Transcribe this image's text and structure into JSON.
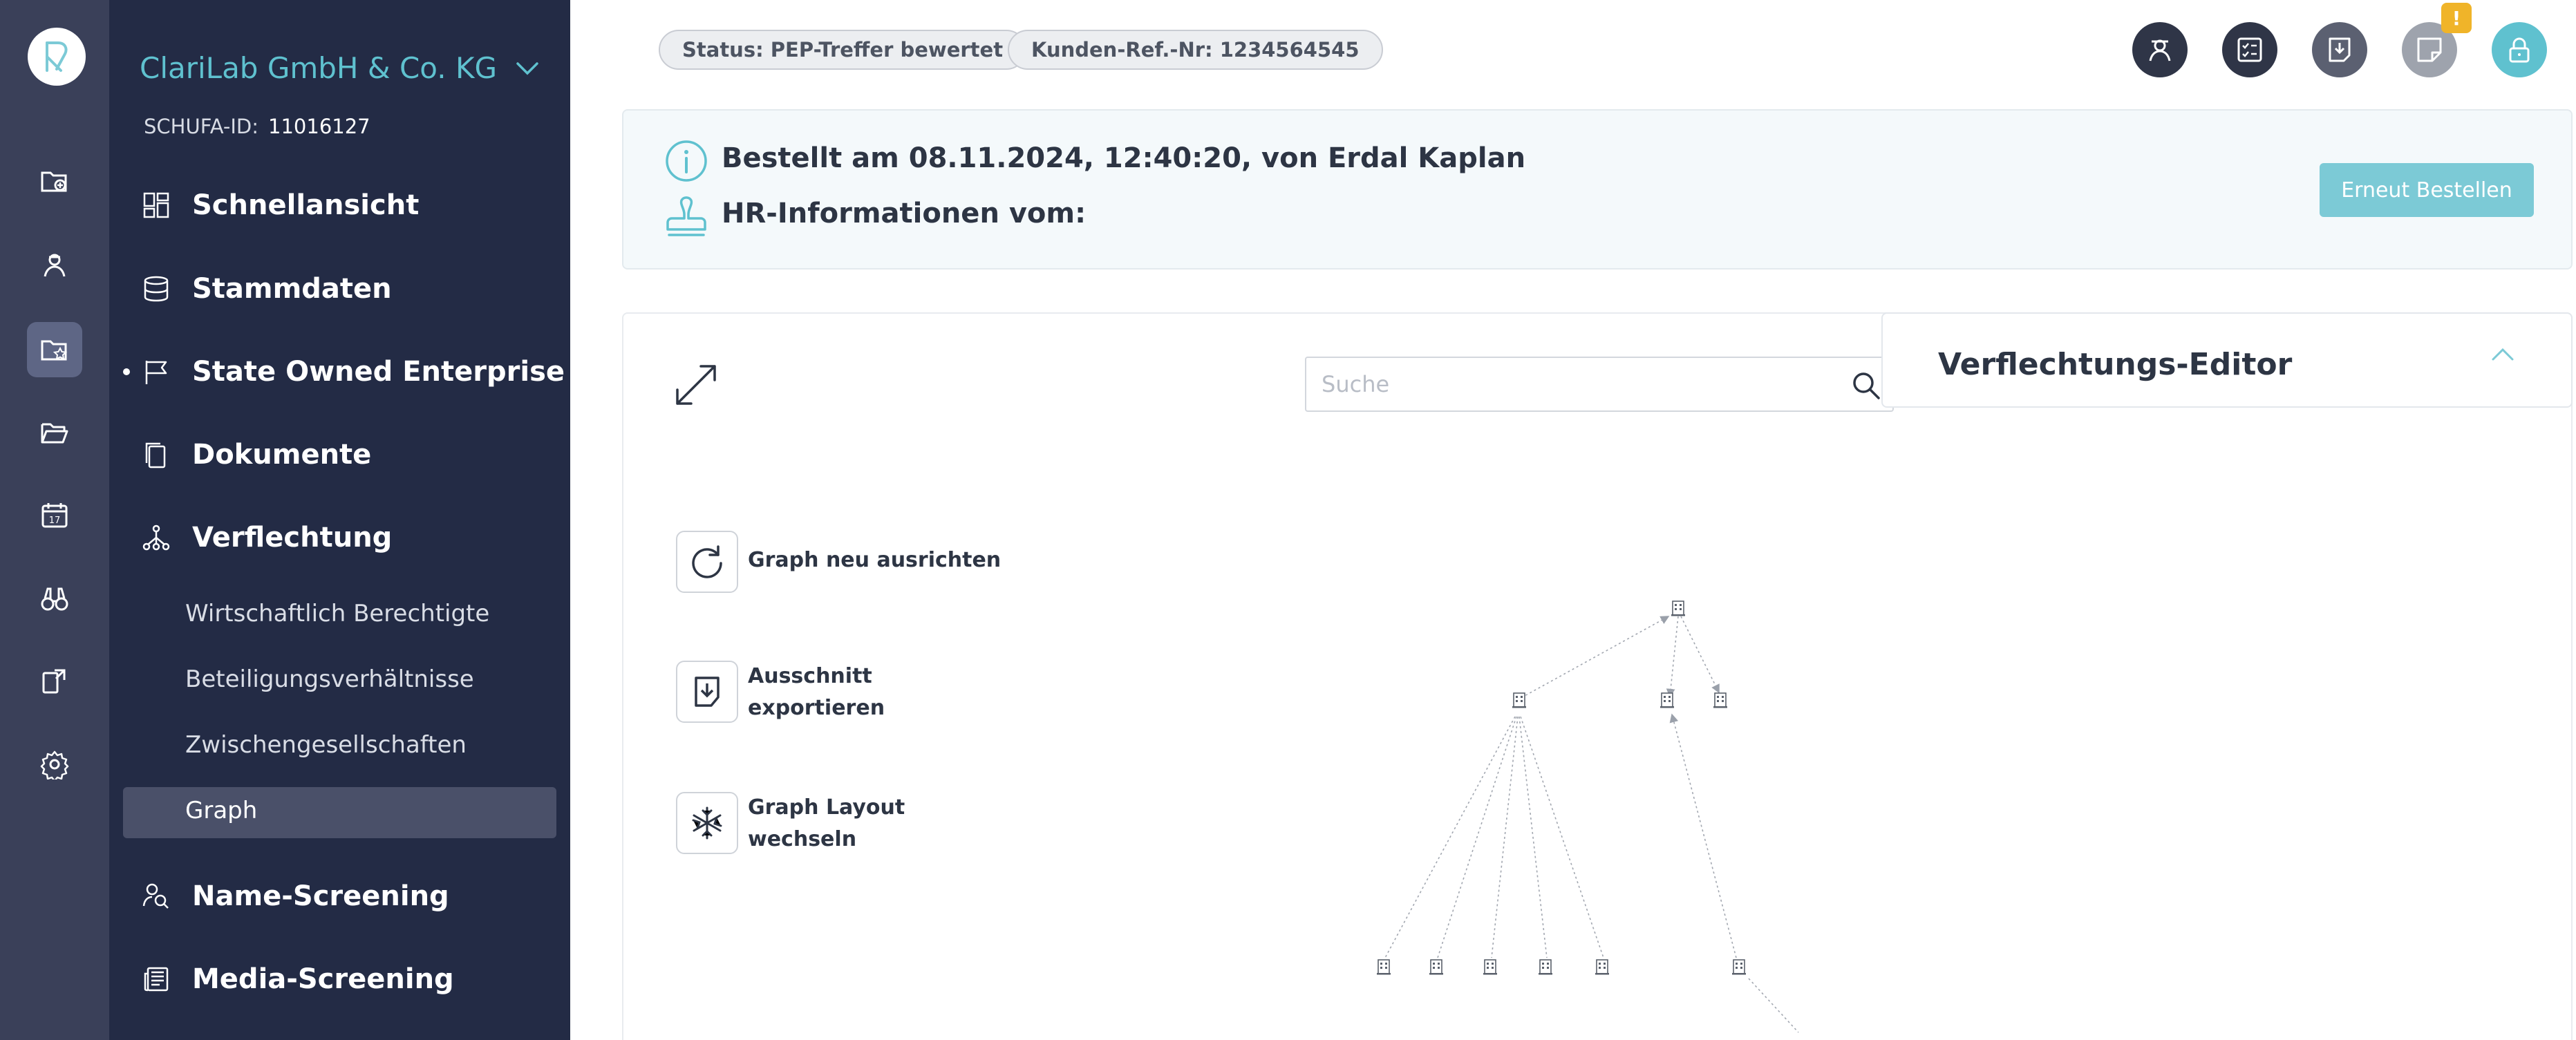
{
  "sidebar": {
    "company_name": "ClariLab GmbH & Co. KG",
    "schufa_label": "SCHUFA-ID:",
    "schufa_id": "11016127",
    "nav": {
      "schnellansicht": "Schnellansicht",
      "stammdaten": "Stammdaten",
      "state_owned": "State Owned Enterprise",
      "dokumente": "Dokumente",
      "verflechtung": "Verflechtung",
      "name_screening": "Name-Screening",
      "media_screening": "Media-Screening"
    },
    "sub": {
      "wirtschaftlich": "Wirtschaftlich Berechtigte",
      "beteiligung": "Beteiligungsverhältnisse",
      "zwischen": "Zwischengesellschaften",
      "graph": "Graph"
    }
  },
  "header": {
    "status": "Status: PEP-Treffer bewertet",
    "kunden_ref": "Kunden-Ref.-Nr: 1234564545",
    "warning_badge": "!"
  },
  "banner": {
    "order_line": "Bestellt am 08.11.2024, 12:40:20, von Erdal Kaplan",
    "hr_line": "HR-Informationen vom:",
    "reorder_button": "Erneut Bestellen"
  },
  "graph": {
    "search_placeholder": "Suche",
    "tool_realign": "Graph neu ausrichten",
    "tool_export_1": "Ausschnitt",
    "tool_export_2": "exportieren",
    "tool_layout_1": "Graph Layout",
    "tool_layout_2": "wechseln"
  },
  "editor": {
    "title": "Verflechtungs-Editor"
  },
  "colors": {
    "rail": "#3a4059",
    "sidebar": "#232b45",
    "accent": "#5fc1cf",
    "button": "#7ccad6",
    "header_dark": "#2f3547"
  }
}
